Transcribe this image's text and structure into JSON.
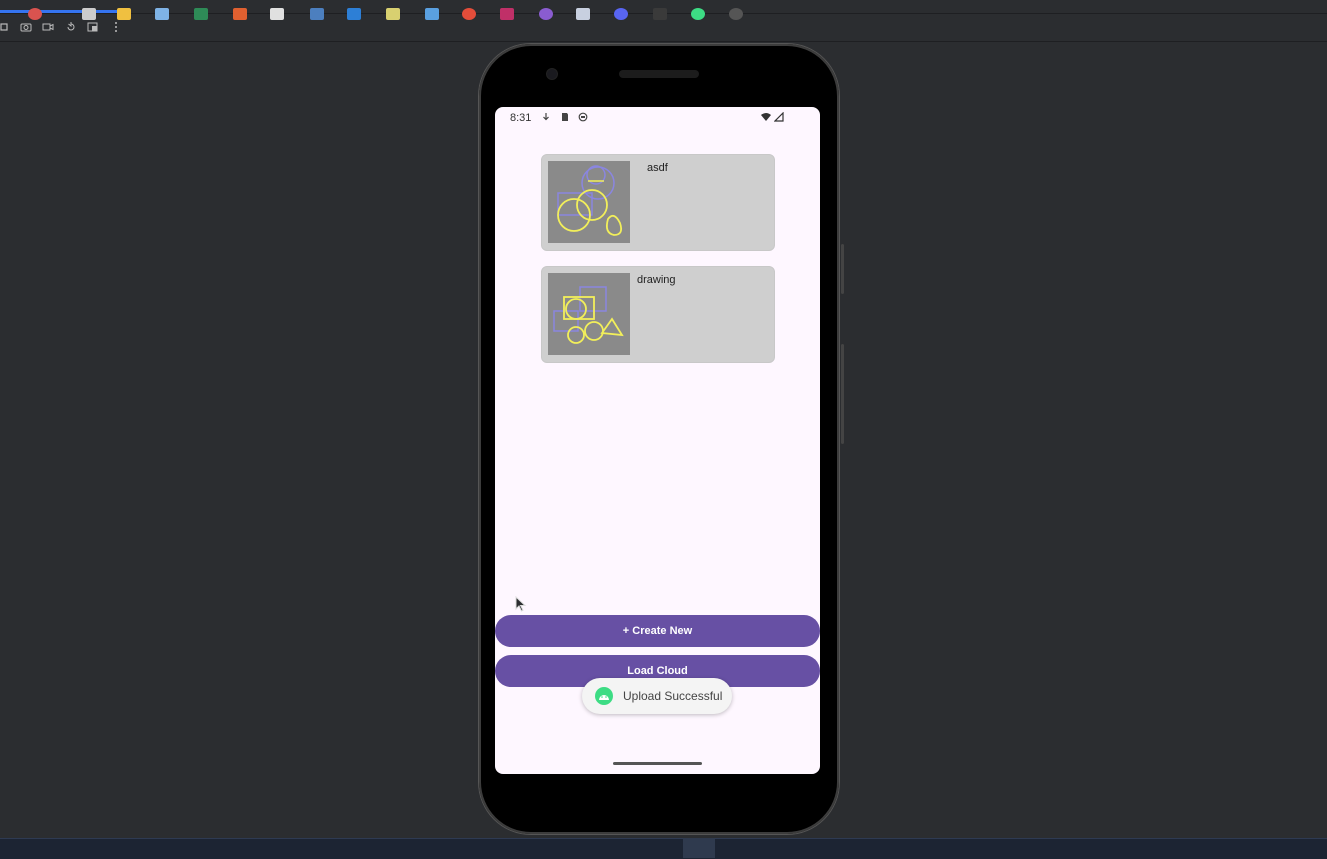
{
  "ide": {
    "toolbar_icons": [
      "stop-icon",
      "camera-icon",
      "video-icon",
      "rotate-icon",
      "device-snapshot-icon",
      "more-icon"
    ]
  },
  "status_bar": {
    "time": "8:31",
    "icons": [
      "download-icon",
      "sd-card-icon",
      "vpn-icon",
      "wifi-icon",
      "signal-icon"
    ]
  },
  "drawings": [
    {
      "title": "asdf"
    },
    {
      "title": "drawing"
    }
  ],
  "buttons": {
    "create_new": "+ Create New",
    "load_cloud": "Load Cloud"
  },
  "toast": {
    "message": "Upload Successful",
    "icon": "android-icon"
  },
  "colors": {
    "primary": "#6750a4",
    "screen_bg": "#fef7ff",
    "card_bg": "#cfcfcf"
  }
}
